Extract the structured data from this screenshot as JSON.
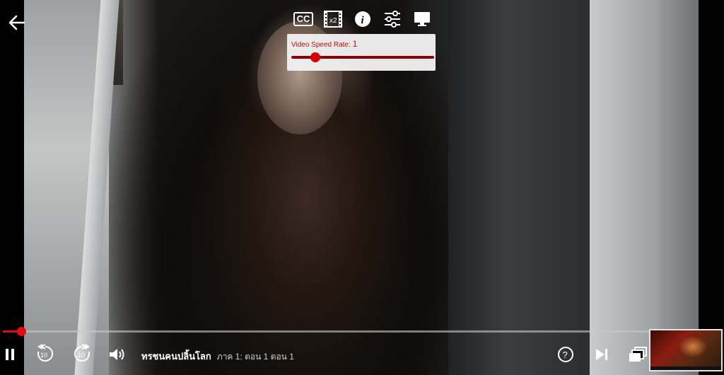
{
  "player": {
    "back_icon": "arrow-left-icon",
    "top_toolbar": {
      "cc_label": "CC",
      "icons": [
        "subtitles-icon",
        "film-speed-icon",
        "info-icon",
        "settings-sliders-icon",
        "display-icon"
      ]
    },
    "speed_control": {
      "label": "Video Speed Rate:",
      "value": "1",
      "slider_fraction": 0.17
    },
    "progress": {
      "played_fraction": 0.026
    },
    "controls": {
      "play_pause_icon": "pause-icon",
      "rewind_icon": "rewind-10-icon",
      "rewind_seconds": "10",
      "forward_icon": "forward-10-icon",
      "forward_seconds": "10",
      "volume_icon": "volume-icon",
      "help_icon": "help-circle-icon",
      "next_episode_icon": "next-episode-icon",
      "episodes_icon": "episodes-list-icon"
    },
    "title": {
      "show": "ทรชนคนปลิ้นโลก",
      "episode_info": "ภาค 1: ตอน 1  ตอน 1"
    },
    "colors": {
      "accent": "#e50914",
      "speed_text": "#b01010"
    }
  }
}
